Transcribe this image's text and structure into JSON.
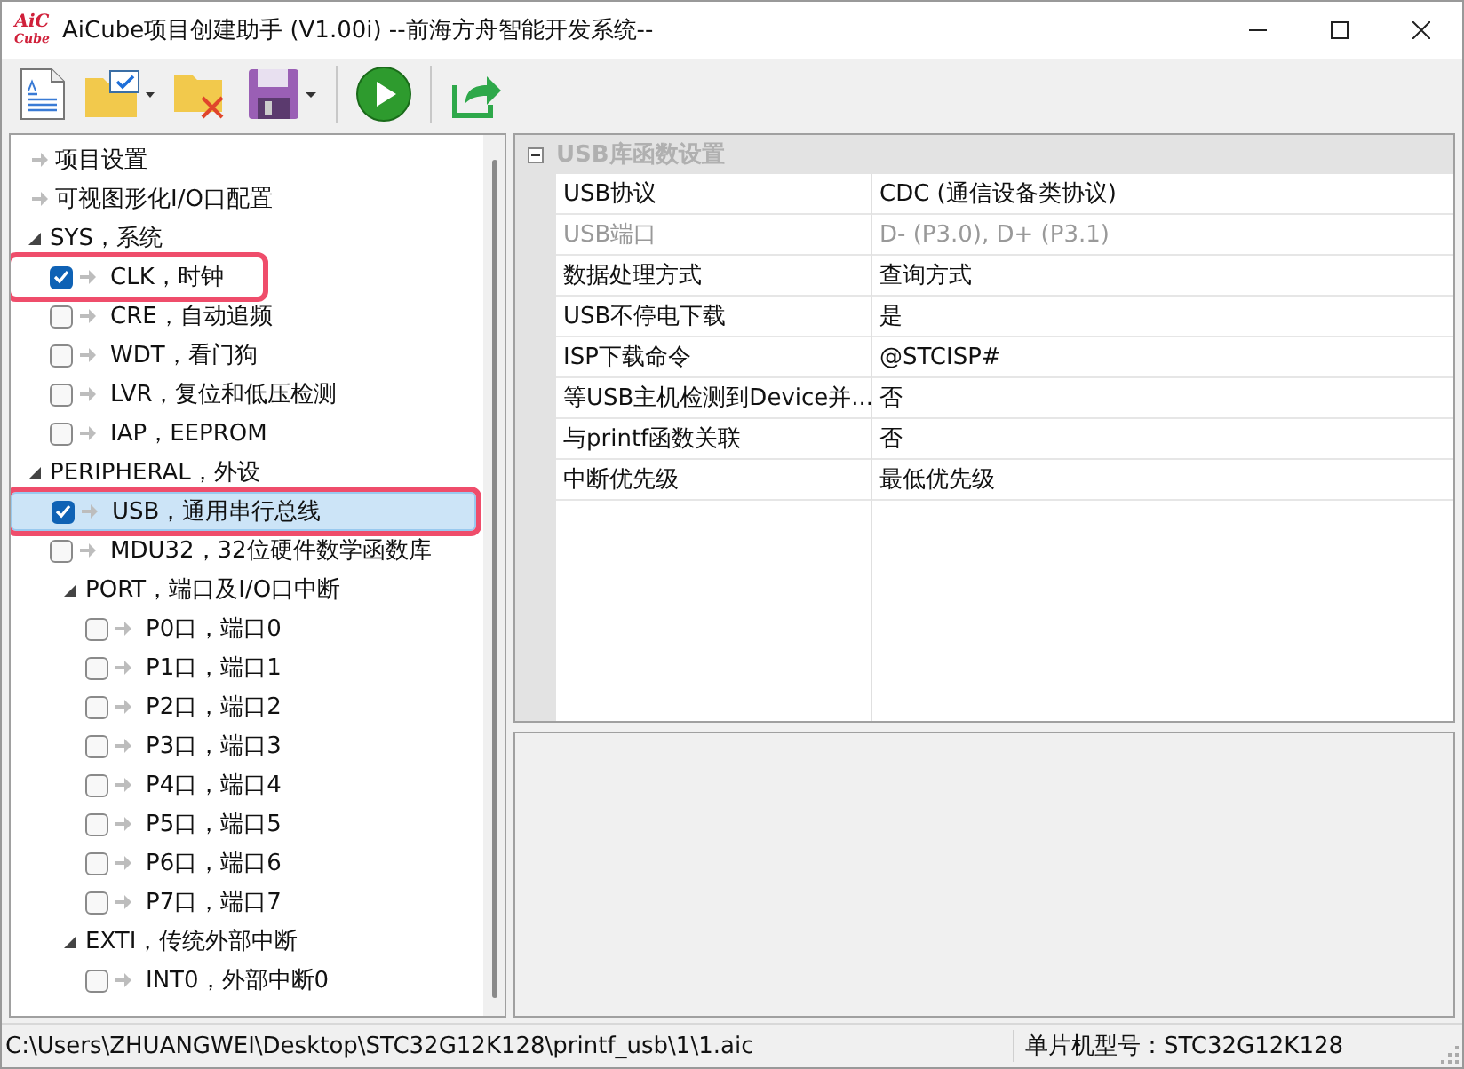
{
  "window": {
    "logo": {
      "top": "AiC",
      "bottom": "Cube"
    },
    "title": "AiCube项目创建助手 (V1.00i) --前海方舟智能开发系统--"
  },
  "tree": [
    {
      "kind": "setting",
      "label": "项目设置",
      "selected": false,
      "highlighted": false
    },
    {
      "kind": "setting",
      "label": "可视图形化I/O口配置",
      "selected": false,
      "highlighted": false
    },
    {
      "kind": "group",
      "label": "SYS，系统",
      "expanded": true,
      "selected": false,
      "highlighted": false,
      "children": [
        {
          "kind": "module",
          "label": "CLK，时钟",
          "checked": true,
          "selected": false,
          "highlighted": true
        },
        {
          "kind": "module",
          "label": "CRE，自动追频",
          "checked": false,
          "selected": false,
          "highlighted": false
        },
        {
          "kind": "module",
          "label": "WDT，看门狗",
          "checked": false,
          "selected": false,
          "highlighted": false
        },
        {
          "kind": "module",
          "label": "LVR，复位和低压检测",
          "checked": false,
          "selected": false,
          "highlighted": false
        },
        {
          "kind": "module",
          "label": "IAP，EEPROM",
          "checked": false,
          "selected": false,
          "highlighted": false
        }
      ]
    },
    {
      "kind": "group",
      "label": "PERIPHERAL，外设",
      "expanded": true,
      "selected": false,
      "highlighted": false,
      "children": [
        {
          "kind": "module",
          "label": "USB，通用串行总线",
          "checked": true,
          "selected": true,
          "highlighted": true
        },
        {
          "kind": "module",
          "label": "MDU32，32位硬件数学函数库",
          "checked": false,
          "selected": false,
          "highlighted": false
        },
        {
          "kind": "group",
          "label": "PORT，端口及I/O口中断",
          "expanded": true,
          "selected": false,
          "highlighted": false,
          "children": [
            {
              "kind": "module",
              "label": "P0口，端口0",
              "checked": false,
              "selected": false,
              "highlighted": false
            },
            {
              "kind": "module",
              "label": "P1口，端口1",
              "checked": false,
              "selected": false,
              "highlighted": false
            },
            {
              "kind": "module",
              "label": "P2口，端口2",
              "checked": false,
              "selected": false,
              "highlighted": false
            },
            {
              "kind": "module",
              "label": "P3口，端口3",
              "checked": false,
              "selected": false,
              "highlighted": false
            },
            {
              "kind": "module",
              "label": "P4口，端口4",
              "checked": false,
              "selected": false,
              "highlighted": false
            },
            {
              "kind": "module",
              "label": "P5口，端口5",
              "checked": false,
              "selected": false,
              "highlighted": false
            },
            {
              "kind": "module",
              "label": "P6口，端口6",
              "checked": false,
              "selected": false,
              "highlighted": false
            },
            {
              "kind": "module",
              "label": "P7口，端口7",
              "checked": false,
              "selected": false,
              "highlighted": false
            }
          ]
        },
        {
          "kind": "group",
          "label": "EXTI，传统外部中断",
          "expanded": true,
          "selected": false,
          "highlighted": false,
          "children": [
            {
              "kind": "module",
              "label": "INT0，外部中断0",
              "checked": false,
              "selected": false,
              "highlighted": false
            }
          ]
        }
      ]
    }
  ],
  "property_grid": {
    "category": "USB库函数设置",
    "expanded": true,
    "rows": [
      {
        "name": "USB协议",
        "value": "CDC (通信设备类协议)",
        "disabled": false
      },
      {
        "name": "USB端口",
        "value": "D- (P3.0), D+ (P3.1)",
        "disabled": true
      },
      {
        "name": "数据处理方式",
        "value": "查询方式",
        "disabled": false
      },
      {
        "name": "USB不停电下载",
        "value": "是",
        "disabled": false
      },
      {
        "name": "ISP下载命令",
        "value": "@STCISP#",
        "disabled": false
      },
      {
        "name": "等USB主机检测到Device并...",
        "value": "否",
        "disabled": false
      },
      {
        "name": "与printf函数关联",
        "value": "否",
        "disabled": false
      },
      {
        "name": "中断优先级",
        "value": "最低优先级",
        "disabled": false
      }
    ]
  },
  "status_bar": {
    "path": "C:\\Users\\ZHUANGWEI\\Desktop\\STC32G12K128\\printf_usb\\1\\1.aic",
    "chip": "单片机型号：STC32G12K128"
  }
}
